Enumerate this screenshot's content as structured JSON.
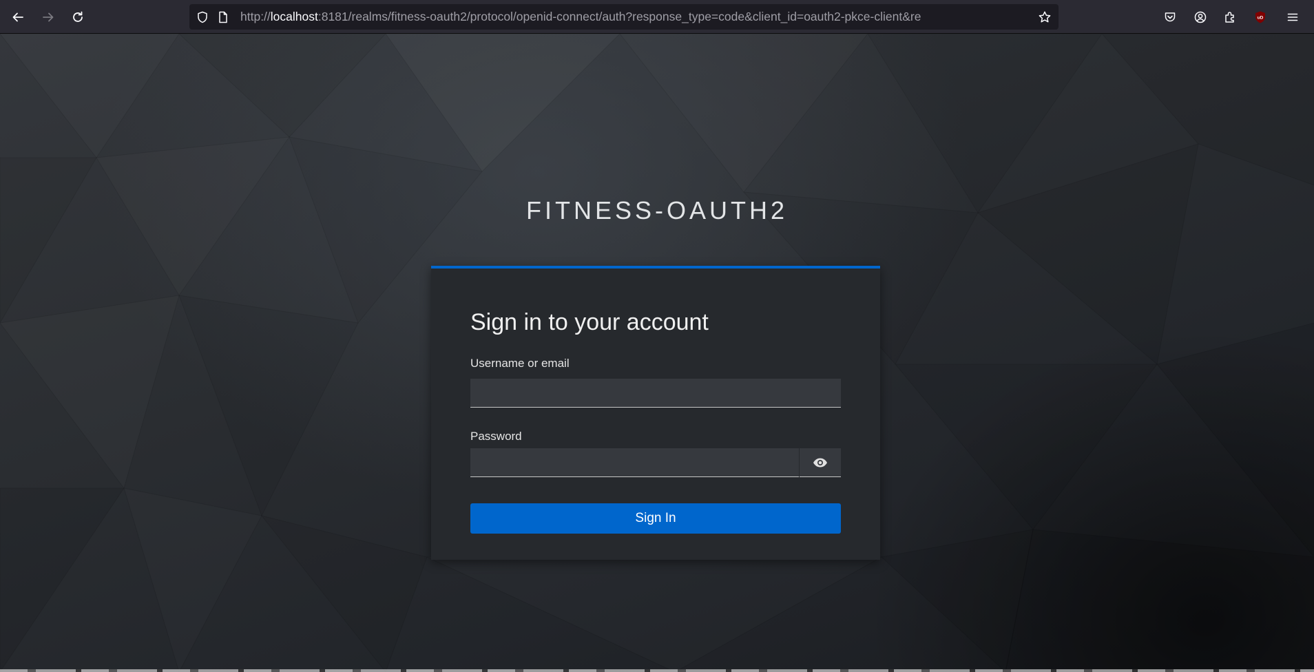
{
  "browser": {
    "url_host_prefix": "http://",
    "url_host": "localhost",
    "url_rest": ":8181/realms/fitness-oauth2/protocol/openid-connect/auth?response_type=code&client_id=oauth2-pkce-client&re",
    "icons": [
      "back-arrow-icon",
      "forward-arrow-icon",
      "reload-icon",
      "shield-icon",
      "page-icon",
      "star-icon",
      "pocket-icon",
      "account-icon",
      "extensions-icon",
      "ublock-icon",
      "menu-icon"
    ],
    "extension_badge": "uD"
  },
  "page": {
    "realm_title": "FITNESS-OAUTH2",
    "login": {
      "heading": "Sign in to your account",
      "username_label": "Username or email",
      "username_value": "",
      "password_label": "Password",
      "password_value": "",
      "submit_label": "Sign In"
    }
  },
  "colors": {
    "accent": "#0066cc",
    "card_background": "#26292d",
    "input_background": "#36393e"
  }
}
